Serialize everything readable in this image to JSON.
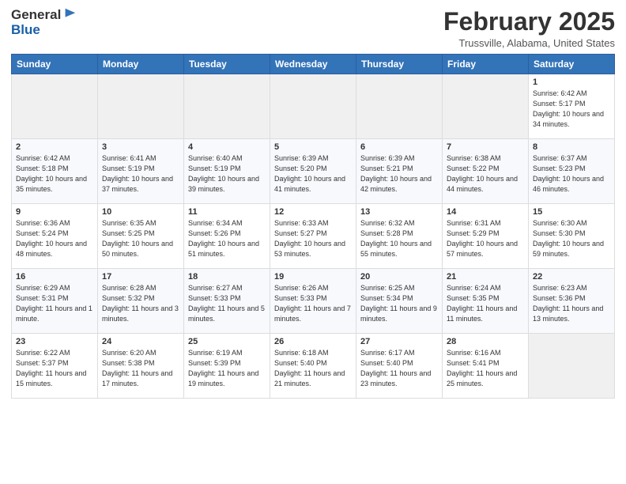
{
  "header": {
    "logo": {
      "general": "General",
      "blue": "Blue"
    },
    "title": "February 2025",
    "location": "Trussville, Alabama, United States"
  },
  "weekdays": [
    "Sunday",
    "Monday",
    "Tuesday",
    "Wednesday",
    "Thursday",
    "Friday",
    "Saturday"
  ],
  "weeks": [
    [
      {
        "day": "",
        "empty": true
      },
      {
        "day": "",
        "empty": true
      },
      {
        "day": "",
        "empty": true
      },
      {
        "day": "",
        "empty": true
      },
      {
        "day": "",
        "empty": true
      },
      {
        "day": "",
        "empty": true
      },
      {
        "day": "1",
        "sunrise": "6:42 AM",
        "sunset": "5:17 PM",
        "daylight": "10 hours and 34 minutes."
      }
    ],
    [
      {
        "day": "2",
        "sunrise": "6:42 AM",
        "sunset": "5:18 PM",
        "daylight": "10 hours and 35 minutes."
      },
      {
        "day": "3",
        "sunrise": "6:41 AM",
        "sunset": "5:19 PM",
        "daylight": "10 hours and 37 minutes."
      },
      {
        "day": "4",
        "sunrise": "6:40 AM",
        "sunset": "5:19 PM",
        "daylight": "10 hours and 39 minutes."
      },
      {
        "day": "5",
        "sunrise": "6:39 AM",
        "sunset": "5:20 PM",
        "daylight": "10 hours and 41 minutes."
      },
      {
        "day": "6",
        "sunrise": "6:39 AM",
        "sunset": "5:21 PM",
        "daylight": "10 hours and 42 minutes."
      },
      {
        "day": "7",
        "sunrise": "6:38 AM",
        "sunset": "5:22 PM",
        "daylight": "10 hours and 44 minutes."
      },
      {
        "day": "8",
        "sunrise": "6:37 AM",
        "sunset": "5:23 PM",
        "daylight": "10 hours and 46 minutes."
      }
    ],
    [
      {
        "day": "9",
        "sunrise": "6:36 AM",
        "sunset": "5:24 PM",
        "daylight": "10 hours and 48 minutes."
      },
      {
        "day": "10",
        "sunrise": "6:35 AM",
        "sunset": "5:25 PM",
        "daylight": "10 hours and 50 minutes."
      },
      {
        "day": "11",
        "sunrise": "6:34 AM",
        "sunset": "5:26 PM",
        "daylight": "10 hours and 51 minutes."
      },
      {
        "day": "12",
        "sunrise": "6:33 AM",
        "sunset": "5:27 PM",
        "daylight": "10 hours and 53 minutes."
      },
      {
        "day": "13",
        "sunrise": "6:32 AM",
        "sunset": "5:28 PM",
        "daylight": "10 hours and 55 minutes."
      },
      {
        "day": "14",
        "sunrise": "6:31 AM",
        "sunset": "5:29 PM",
        "daylight": "10 hours and 57 minutes."
      },
      {
        "day": "15",
        "sunrise": "6:30 AM",
        "sunset": "5:30 PM",
        "daylight": "10 hours and 59 minutes."
      }
    ],
    [
      {
        "day": "16",
        "sunrise": "6:29 AM",
        "sunset": "5:31 PM",
        "daylight": "11 hours and 1 minute."
      },
      {
        "day": "17",
        "sunrise": "6:28 AM",
        "sunset": "5:32 PM",
        "daylight": "11 hours and 3 minutes."
      },
      {
        "day": "18",
        "sunrise": "6:27 AM",
        "sunset": "5:33 PM",
        "daylight": "11 hours and 5 minutes."
      },
      {
        "day": "19",
        "sunrise": "6:26 AM",
        "sunset": "5:33 PM",
        "daylight": "11 hours and 7 minutes."
      },
      {
        "day": "20",
        "sunrise": "6:25 AM",
        "sunset": "5:34 PM",
        "daylight": "11 hours and 9 minutes."
      },
      {
        "day": "21",
        "sunrise": "6:24 AM",
        "sunset": "5:35 PM",
        "daylight": "11 hours and 11 minutes."
      },
      {
        "day": "22",
        "sunrise": "6:23 AM",
        "sunset": "5:36 PM",
        "daylight": "11 hours and 13 minutes."
      }
    ],
    [
      {
        "day": "23",
        "sunrise": "6:22 AM",
        "sunset": "5:37 PM",
        "daylight": "11 hours and 15 minutes."
      },
      {
        "day": "24",
        "sunrise": "6:20 AM",
        "sunset": "5:38 PM",
        "daylight": "11 hours and 17 minutes."
      },
      {
        "day": "25",
        "sunrise": "6:19 AM",
        "sunset": "5:39 PM",
        "daylight": "11 hours and 19 minutes."
      },
      {
        "day": "26",
        "sunrise": "6:18 AM",
        "sunset": "5:40 PM",
        "daylight": "11 hours and 21 minutes."
      },
      {
        "day": "27",
        "sunrise": "6:17 AM",
        "sunset": "5:40 PM",
        "daylight": "11 hours and 23 minutes."
      },
      {
        "day": "28",
        "sunrise": "6:16 AM",
        "sunset": "5:41 PM",
        "daylight": "11 hours and 25 minutes."
      },
      {
        "day": "",
        "empty": true
      }
    ]
  ]
}
